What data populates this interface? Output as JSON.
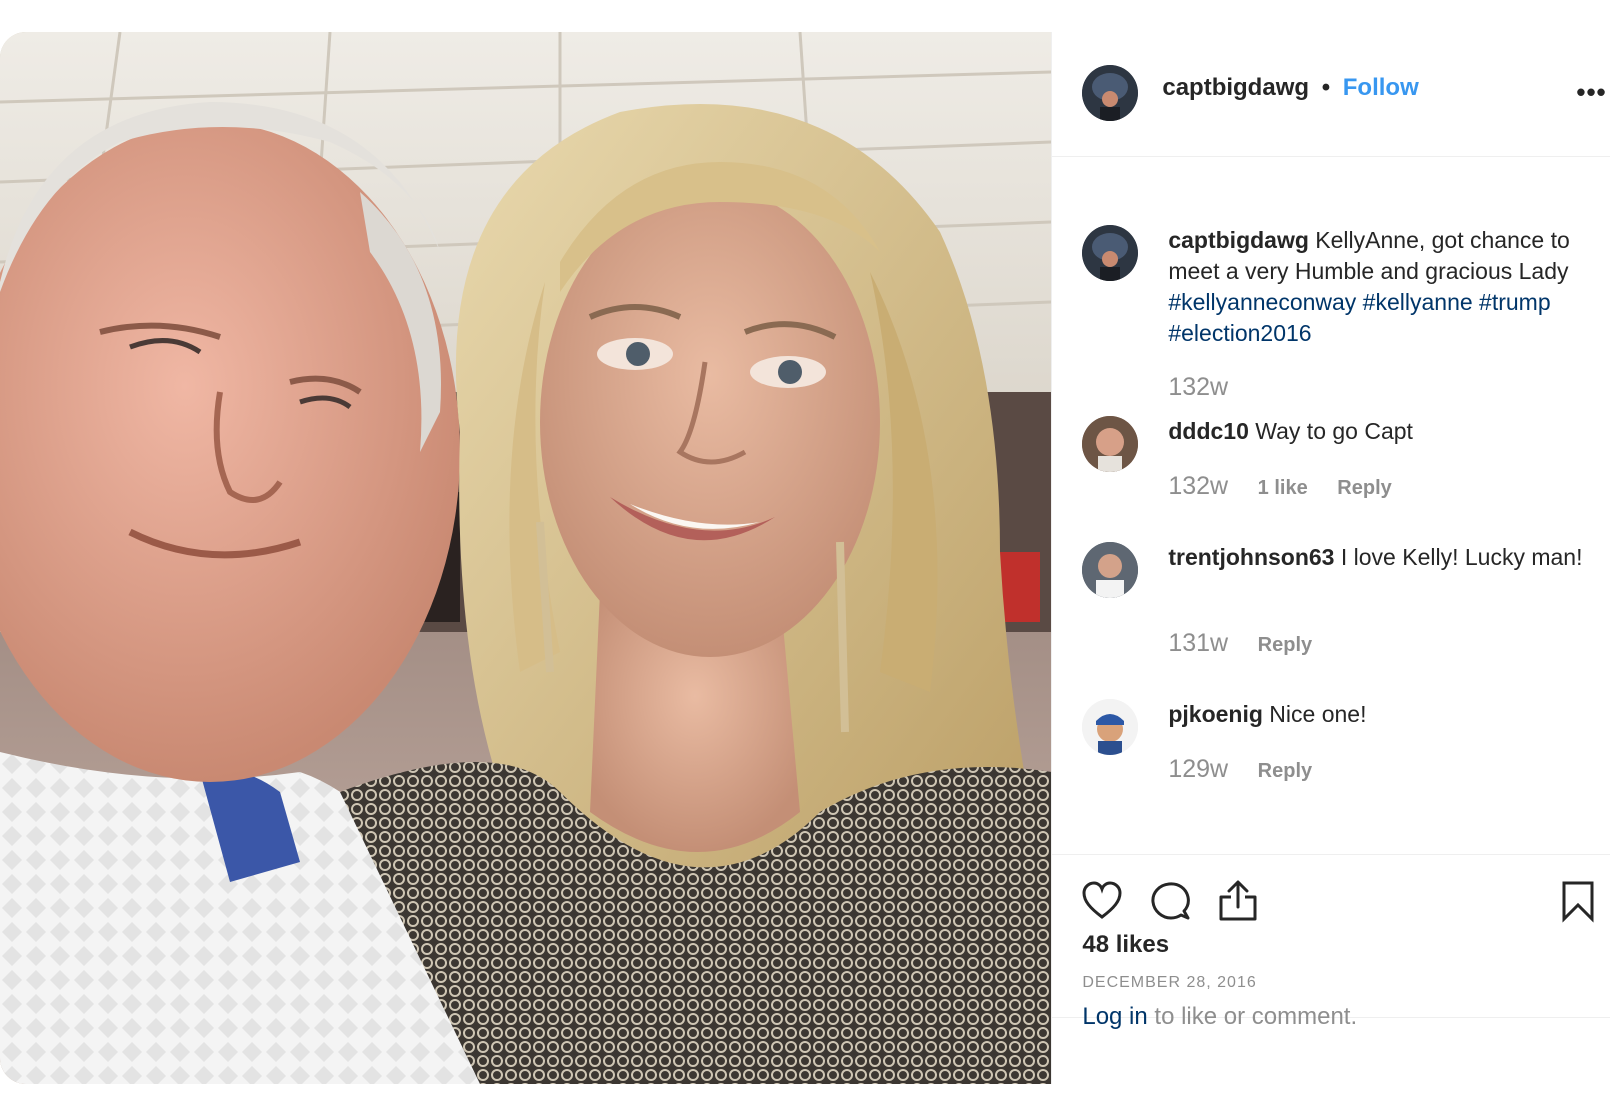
{
  "post": {
    "username": "captbigdawg",
    "separator": "•",
    "follow_label": "Follow",
    "more_label": "•••"
  },
  "caption": {
    "username": "captbigdawg",
    "text": "KellyAnne, got chance to meet a very Humble and gracious Lady",
    "hashtags": "#kellyanneconway #kellyanne #trump #election2016",
    "time": "132w"
  },
  "comments": [
    {
      "username": "dddc10",
      "text": "Way to go Capt",
      "time": "132w",
      "likes": "1 like",
      "reply": "Reply"
    },
    {
      "username": "trentjohnson63",
      "text": "I love Kelly! Lucky man!",
      "time": "131w",
      "reply": "Reply"
    },
    {
      "username": "pjkoenig",
      "text": "Nice one!",
      "time": "129w",
      "reply": "Reply"
    }
  ],
  "stats": {
    "likes": "48 likes",
    "date": "DECEMBER 28, 2016"
  },
  "footer": {
    "login_link": "Log in",
    "login_text": " to like or comment."
  },
  "icons": {
    "heart": "heart-icon",
    "comment": "comment-icon",
    "share": "share-icon",
    "save": "bookmark-icon"
  },
  "colors": {
    "follow": "#3897f0",
    "hashtag": "#003569",
    "muted": "#8e8e8e",
    "text": "#262626"
  }
}
